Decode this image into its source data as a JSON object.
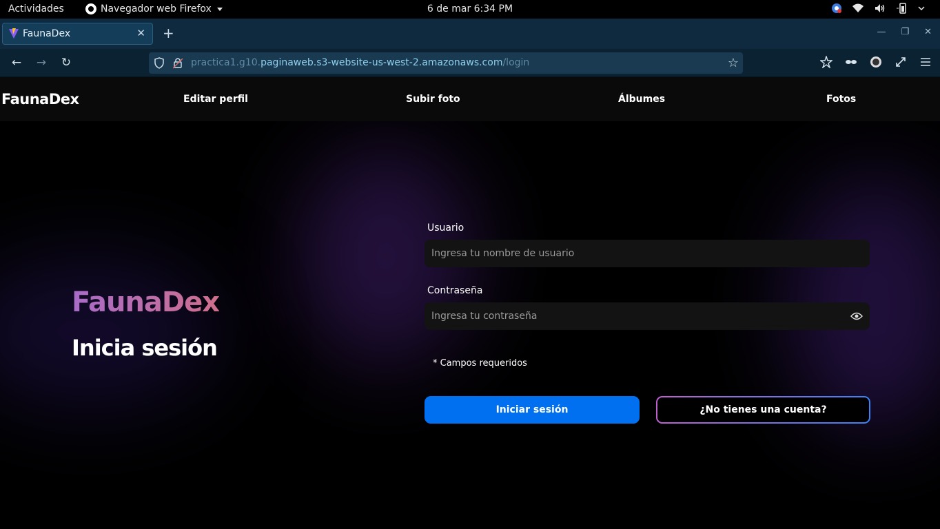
{
  "os_topbar": {
    "activities": "Actividades",
    "app_name": "Navegador web Firefox",
    "clock": "6 de mar   6:34 PM"
  },
  "browser": {
    "tab": {
      "title": "FaunaDex"
    },
    "url": {
      "prefix": "practica1.g10.",
      "domain": "paginaweb.s3-website-us-west-2.amazonaws.com",
      "path": "/login"
    }
  },
  "site": {
    "brand": "FaunaDex",
    "nav": [
      "Editar perfil",
      "Subir foto",
      "Álbumes",
      "Fotos"
    ]
  },
  "hero": {
    "title": "FaunaDex",
    "subtitle": "Inicia sesión"
  },
  "form": {
    "user_label": "Usuario",
    "user_placeholder": "Ingresa tu nombre de usuario",
    "password_label": "Contraseña",
    "password_placeholder": "Ingresa tu contraseña",
    "required_note": "* Campos requeridos",
    "login_button": "Iniciar sesión",
    "register_button": "¿No tienes una cuenta?"
  },
  "colors": {
    "primary_button": "#0070f0",
    "brand_gradient_start": "#a86cc8",
    "brand_gradient_end": "#cf6f8c",
    "browser_chrome": "#0f2a3f"
  }
}
